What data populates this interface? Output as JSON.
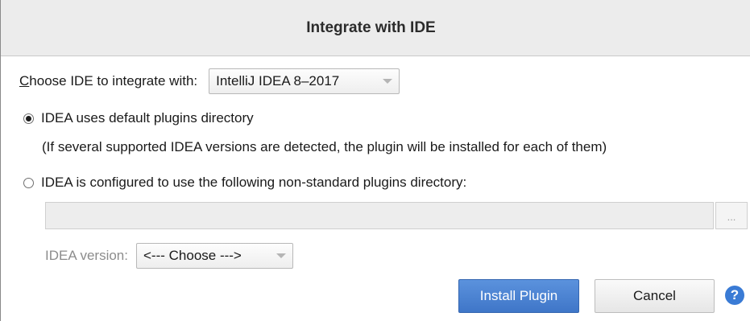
{
  "dialog": {
    "title": "Integrate with IDE"
  },
  "ide_chooser": {
    "label_mnemonic": "C",
    "label_rest": "hoose IDE to integrate with:",
    "selected": "IntelliJ IDEA 8–2017"
  },
  "options": {
    "default_dir": {
      "label": "IDEA uses default plugins directory",
      "checked": true,
      "note": "(If several supported IDEA versions are detected, the plugin will be installed for each of them)"
    },
    "custom_dir": {
      "label": "IDEA is configured to use the following non-standard plugins directory:",
      "checked": false,
      "path_value": "",
      "browse_label": "..."
    }
  },
  "idea_version": {
    "label": "IDEA version:",
    "selected": "<--- Choose --->"
  },
  "buttons": {
    "install": "Install Plugin",
    "cancel": "Cancel",
    "help": "?"
  },
  "colors": {
    "primary": "#4a84d2",
    "title_bar": "#ececec",
    "help_icon": "#3a7bd5",
    "disabled_text": "#8c8c8c"
  }
}
